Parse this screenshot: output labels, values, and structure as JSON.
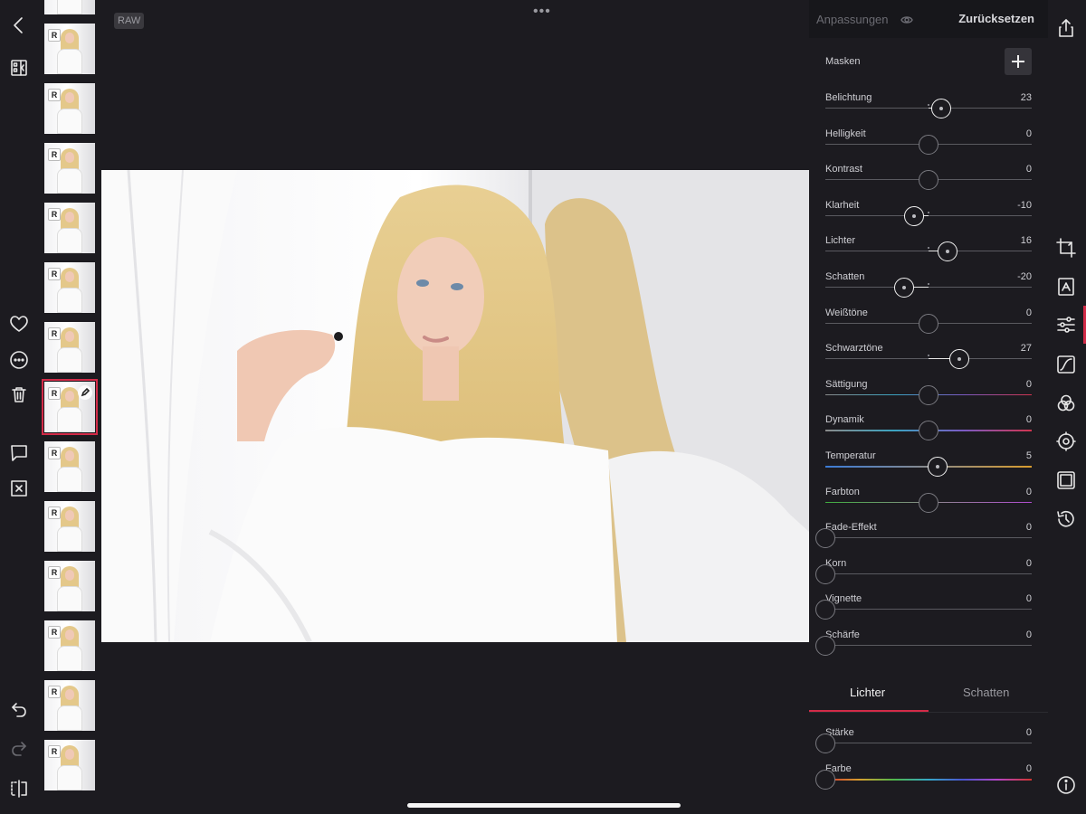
{
  "canvas": {
    "raw_badge": "RAW",
    "more_dots": "•••"
  },
  "panel": {
    "title": "Anpassungen",
    "reset_label": "Zurücksetzen",
    "masks_label": "Masken",
    "sliders": [
      {
        "label": "Belichtung",
        "value": "23",
        "position": 0.56,
        "gradient": "none"
      },
      {
        "label": "Helligkeit",
        "value": "0",
        "position": 0.5,
        "gradient": "none"
      },
      {
        "label": "Kontrast",
        "value": "0",
        "position": 0.5,
        "gradient": "none"
      },
      {
        "label": "Klarheit",
        "value": "-10",
        "position": 0.43,
        "gradient": "none"
      },
      {
        "label": "Lichter",
        "value": "16",
        "position": 0.59,
        "gradient": "none"
      },
      {
        "label": "Schatten",
        "value": "-20",
        "position": 0.38,
        "gradient": "none"
      },
      {
        "label": "Weißtöne",
        "value": "0",
        "position": 0.5,
        "gradient": "none"
      },
      {
        "label": "Schwarztöne",
        "value": "27",
        "position": 0.65,
        "gradient": "none"
      },
      {
        "label": "Sättigung",
        "value": "0",
        "position": 0.5,
        "gradient": "saturation"
      },
      {
        "label": "Dynamik",
        "value": "0",
        "position": 0.5,
        "gradient": "saturation"
      },
      {
        "label": "Temperatur",
        "value": "5",
        "position": 0.545,
        "gradient": "temperature"
      },
      {
        "label": "Farbton",
        "value": "0",
        "position": 0.5,
        "gradient": "tint"
      },
      {
        "label": "Fade-Effekt",
        "value": "0",
        "position": 0,
        "gradient": "none"
      },
      {
        "label": "Korn",
        "value": "0",
        "position": 0,
        "gradient": "none"
      },
      {
        "label": "Vignette",
        "value": "0",
        "position": 0,
        "gradient": "none"
      },
      {
        "label": "Schärfe",
        "value": "0",
        "position": 0,
        "gradient": "none"
      }
    ],
    "tabs": [
      {
        "label": "Lichter",
        "active": true
      },
      {
        "label": "Schatten",
        "active": false
      }
    ],
    "split_toning": [
      {
        "label": "Stärke",
        "value": "0",
        "position": 0,
        "gradient": "none"
      },
      {
        "label": "Farbe",
        "value": "0",
        "position": 0,
        "gradient": "hue"
      }
    ]
  },
  "filmstrip": {
    "badge": "R",
    "selected_index": 7,
    "thumbnail_count": 14
  },
  "colors": {
    "accent": "#d22b48",
    "background": "#1c1b20",
    "text": "#e6e6e6",
    "muted_text": "#6b6b72"
  },
  "icons": {
    "left": [
      "back-icon",
      "filter-list-icon",
      "heart-icon",
      "more-circle-icon",
      "trash-icon",
      "comment-icon",
      "reject-flag-icon",
      "undo-icon",
      "redo-icon",
      "compare-icon"
    ],
    "right": [
      "share-icon",
      "crop-icon",
      "auto-icon",
      "adjust-sliders-icon",
      "curve-icon",
      "color-mix-icon",
      "selective-icon",
      "frame-icon",
      "history-icon",
      "info-icon"
    ]
  }
}
